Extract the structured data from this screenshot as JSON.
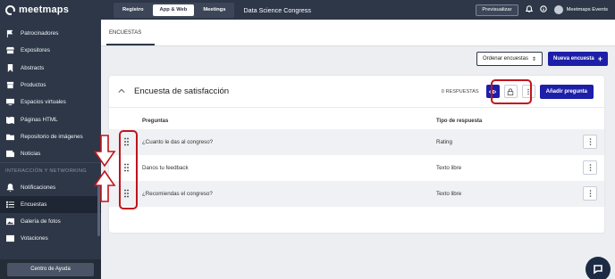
{
  "brand": {
    "logo_text": "meetmaps"
  },
  "sidebar": {
    "items_top": [
      {
        "label": "Patrocinadores",
        "icon": "flag-icon"
      },
      {
        "label": "Expositores",
        "icon": "storefront-icon"
      },
      {
        "label": "Abstracts",
        "icon": "bookmark-icon"
      },
      {
        "label": "Productos",
        "icon": "box-icon"
      },
      {
        "label": "Espacios virtuales",
        "icon": "screen-icon"
      },
      {
        "label": "Páginas HTML",
        "icon": "map-icon"
      },
      {
        "label": "Repositorio de imágenes",
        "icon": "folder-icon"
      },
      {
        "label": "Noticias",
        "icon": "newspaper-icon"
      }
    ],
    "section_label": "INTERACCIÓN Y NETWORKING",
    "items_bottom": [
      {
        "label": "Notificaciones",
        "icon": "bell-icon"
      },
      {
        "label": "Encuestas",
        "icon": "list-icon"
      },
      {
        "label": "Galería de fotos",
        "icon": "gallery-icon"
      },
      {
        "label": "Votaciones",
        "icon": "vote-icon"
      }
    ],
    "help_label": "Centro de Ayuda"
  },
  "topbar": {
    "tabs": [
      {
        "label": "Registro",
        "active": false
      },
      {
        "label": "App & Web",
        "active": true
      },
      {
        "label": "Meetings",
        "active": false
      }
    ],
    "event_title": "Data Science Congress",
    "preview_label": "Previsualizar",
    "user_name": "Meetmaps Events"
  },
  "page": {
    "tab_label": "ENCUESTAS",
    "order_label": "Ordenar encuestas",
    "new_label": "Nueva encuesta"
  },
  "survey": {
    "title": "Encuesta de satisfacción",
    "responses": "0 RESPUESTAS",
    "add_question_label": "Añadir pregunta",
    "col_questions": "Preguntas",
    "col_type": "Tipo de respuesta",
    "rows": [
      {
        "question": "¿Cuanto le das al congreso?",
        "type": "Rating"
      },
      {
        "question": "Danos tu feedback",
        "type": "Texto libre"
      },
      {
        "question": "¿Recomiendas el congreso?",
        "type": "Texto libre"
      }
    ]
  },
  "colors": {
    "accent": "#1d1fa8",
    "sidebar": "#2d3748",
    "annotation": "#c0141c"
  }
}
